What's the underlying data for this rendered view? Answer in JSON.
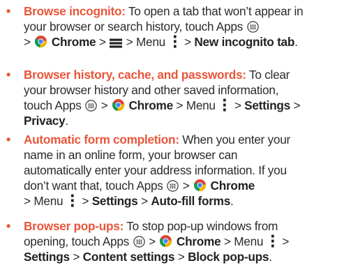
{
  "tips": [
    {
      "title": "Browse incognito:",
      "text1": " To open a tab that won’t appear in",
      "text2": "your browser or search history, touch Apps ",
      "sep": " > ",
      "chrome": "Chrome",
      "menu": "Menu",
      "final": "New incognito tab",
      "end": "."
    },
    {
      "title": "Browser history, cache, and passwords:",
      "text1": " To clear",
      "text2": "your browser history and other saved information,",
      "text3": "touch Apps ",
      "sep": " > ",
      "chrome": "Chrome",
      "menu": "Menu",
      "settings": "Settings",
      "privacy": "Privacy",
      "end": "."
    },
    {
      "title": "Automatic form completion:",
      "text1": " When you enter your",
      "text2": "name in an online form, your browser can",
      "text3": "automatically enter your address information. If you",
      "text4": "don’t want that, touch Apps ",
      "sep": " > ",
      "chrome": "Chrome",
      "menu": "Menu",
      "settings": "Settings",
      "final": "Auto-fill forms",
      "end": "."
    },
    {
      "title": "Browser pop-ups:",
      "text1": " To stop pop-up windows from",
      "text2": "opening, touch Apps ",
      "sep": " > ",
      "chrome": "Chrome",
      "menu": "Menu",
      "settings": "Settings",
      "content": "Content settings",
      "final": "Block pop-ups",
      "end": "."
    }
  ],
  "bullet": "•",
  "colors": {
    "accent": "#e8563a",
    "text": "#2b2b2b"
  },
  "icons": [
    "apps-icon",
    "chrome-icon",
    "menu-lines-icon",
    "overflow-menu-icon"
  ]
}
